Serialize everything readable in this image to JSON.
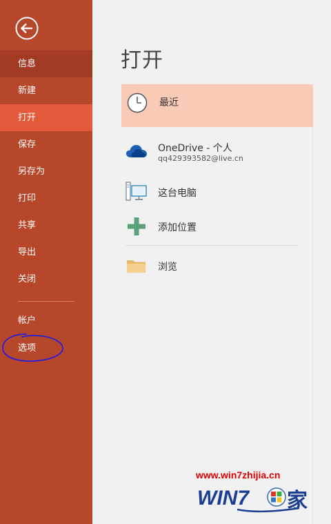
{
  "sidebar": {
    "items": [
      {
        "label": "信息"
      },
      {
        "label": "新建"
      },
      {
        "label": "打开"
      },
      {
        "label": "保存"
      },
      {
        "label": "另存为"
      },
      {
        "label": "打印"
      },
      {
        "label": "共享"
      },
      {
        "label": "导出"
      },
      {
        "label": "关闭"
      },
      {
        "label": "帐户"
      },
      {
        "label": "选项"
      }
    ]
  },
  "main": {
    "title": "打开",
    "locations": [
      {
        "title": "最近",
        "icon": "clock-icon"
      },
      {
        "title": "OneDrive - 个人",
        "subtitle": "qq429393582@live.cn",
        "icon": "onedrive-cloud-icon"
      },
      {
        "title": "这台电脑",
        "icon": "computer-icon"
      },
      {
        "title": "添加位置",
        "icon": "plus-icon"
      },
      {
        "title": "浏览",
        "icon": "folder-icon"
      }
    ]
  },
  "watermark": {
    "url": "www.win7zhijia.cn",
    "brand": "WIN7",
    "brand_suffix": "家"
  },
  "colors": {
    "sidebar": "#b7472a",
    "sidebar_info": "#a13b24",
    "sidebar_active": "#e35b3a",
    "selected_row": "#f9cbb7",
    "annotation": "#2a1ed6"
  }
}
